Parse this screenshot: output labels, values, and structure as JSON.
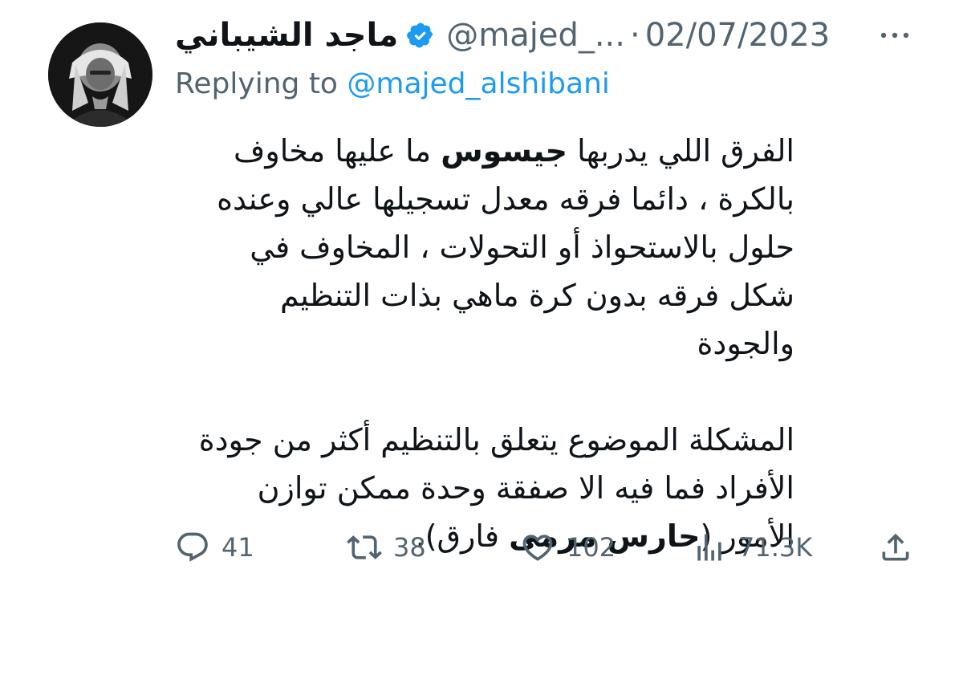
{
  "author": {
    "display_name": "ماجد الشيباني",
    "handle": "@majed_...",
    "separator": "·",
    "date": "02/07/2023",
    "verified_color": "#1d9bf0"
  },
  "reply": {
    "prefix": "Replying to ",
    "mention": "@majed_alshibani"
  },
  "body": {
    "p1_part1": "الفرق اللي يدربها ",
    "p1_bold": "جيسوس",
    "p1_part2": " ما عليها مخاوف بالكرة ، دائما فرقه معدل تسجيلها عالي وعنده حلول بالاستحواذ أو التحولات ، المخاوف في شكل فرقه بدون كرة ماهي بذات التنظيم والجودة",
    "p2_part1": "المشكلة الموضوع يتعلق بالتنظيم أكثر من جودة الأفراد فما فيه الا صفقة وحدة ممكن توازن الأمور (",
    "p2_bold": "حارس مرمى",
    "p2_part2": " فارق)."
  },
  "actions": {
    "reply_count": "41",
    "retweet_count": "38",
    "like_count": "102",
    "views_count": "71.3K",
    "icon_color": "#536471"
  },
  "icons": {
    "more": "more-dots-icon",
    "reply": "reply-bubble-icon",
    "retweet": "retweet-arrows-icon",
    "like": "heart-icon",
    "views": "bar-chart-icon",
    "share": "share-upload-icon",
    "verified": "verified-badge-icon"
  }
}
